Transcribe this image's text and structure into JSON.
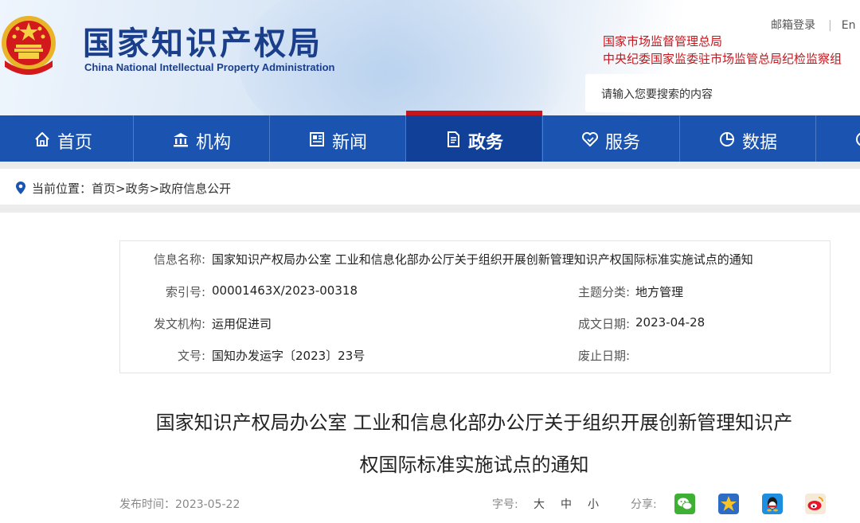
{
  "header": {
    "site_title": "国家知识产权局",
    "site_subtitle": "China National Intellectual Property Administration",
    "mailbox_login": "邮箱登录",
    "lang_switch": "En",
    "notices": [
      "国家市场监督管理总局",
      "中央纪委国家监委驻市场监管总局纪检监察组"
    ],
    "search_placeholder": "请输入您要搜索的内容"
  },
  "nav": {
    "items": [
      {
        "label": "首页",
        "icon": "home-icon"
      },
      {
        "label": "机构",
        "icon": "building-icon"
      },
      {
        "label": "新闻",
        "icon": "newspaper-icon"
      },
      {
        "label": "政务",
        "icon": "document-icon",
        "active": true
      },
      {
        "label": "服务",
        "icon": "heart-check-icon"
      },
      {
        "label": "数据",
        "icon": "pie-chart-icon"
      }
    ]
  },
  "breadcrumb": {
    "prefix": "当前位置：",
    "path": "首页>政务>政府信息公开"
  },
  "info": {
    "name_label": "信息名称:",
    "name_value": "国家知识产权局办公室 工业和信息化部办公厅关于组织开展创新管理知识产权国际标准实施试点的通知",
    "index_label": "索引号:",
    "index_value": "00001463X/2023-00318",
    "topic_label": "主题分类:",
    "topic_value": "地方管理",
    "org_label": "发文机构:",
    "org_value": "运用促进司",
    "date_label": "成文日期:",
    "date_value": "2023-04-28",
    "docno_label": "文号:",
    "docno_value": "国知办发运字〔2023〕23号",
    "expire_label": "废止日期:",
    "expire_value": ""
  },
  "document": {
    "title_line1": "国家知识产权局办公室 工业和信息化部办公厅关于组织开展创新管理知识产",
    "title_line2": "权国际标准实施试点的通知",
    "publish_label": "发布时间：",
    "publish_date": "2023-05-22",
    "font_size_label": "字号:",
    "font_sizes": [
      "大",
      "中",
      "小"
    ],
    "share_label": "分享:"
  },
  "colors": {
    "brand_blue": "#1a53b0",
    "nav_active": "#104098",
    "accent_red": "#c4161c"
  }
}
